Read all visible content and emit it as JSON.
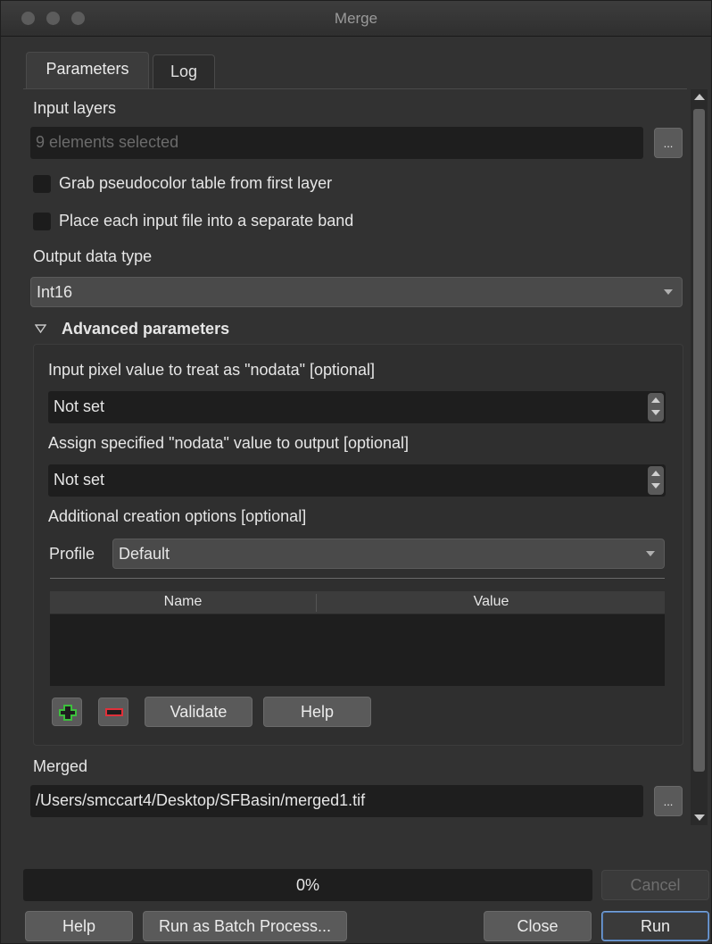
{
  "window": {
    "title": "Merge"
  },
  "tabs": [
    {
      "label": "Parameters"
    },
    {
      "label": "Log"
    }
  ],
  "params": {
    "input_layers_label": "Input layers",
    "input_layers_value": "9 elements selected",
    "browse_label": "...",
    "grab_pseudocolor_label": "Grab pseudocolor table from first layer",
    "separate_band_label": "Place each input file into a separate band",
    "output_type_label": "Output data type",
    "output_type_value": "Int16"
  },
  "advanced": {
    "header": "Advanced parameters",
    "nodata_input_label": "Input pixel value to treat as \"nodata\" [optional]",
    "nodata_input_value": "Not set",
    "nodata_output_label": "Assign specified \"nodata\" value to output [optional]",
    "nodata_output_value": "Not set",
    "creation_options_label": "Additional creation options [optional]",
    "profile_label": "Profile",
    "profile_value": "Default",
    "table_columns": [
      "Name",
      "Value"
    ],
    "validate_label": "Validate",
    "help_label": "Help"
  },
  "merged": {
    "label": "Merged",
    "value": "/Users/smccart4/Desktop/SFBasin/merged1.tif",
    "browse_label": "..."
  },
  "progress": {
    "text": "0%",
    "fraction": 0
  },
  "footer": {
    "cancel_label": "Cancel",
    "help_label": "Help",
    "batch_label": "Run as Batch Process...",
    "close_label": "Close",
    "run_label": "Run"
  },
  "colors": {
    "add_icon": "#3cbf3c",
    "remove_icon": "#e0303a",
    "focus_border": "#7aa3d8"
  }
}
